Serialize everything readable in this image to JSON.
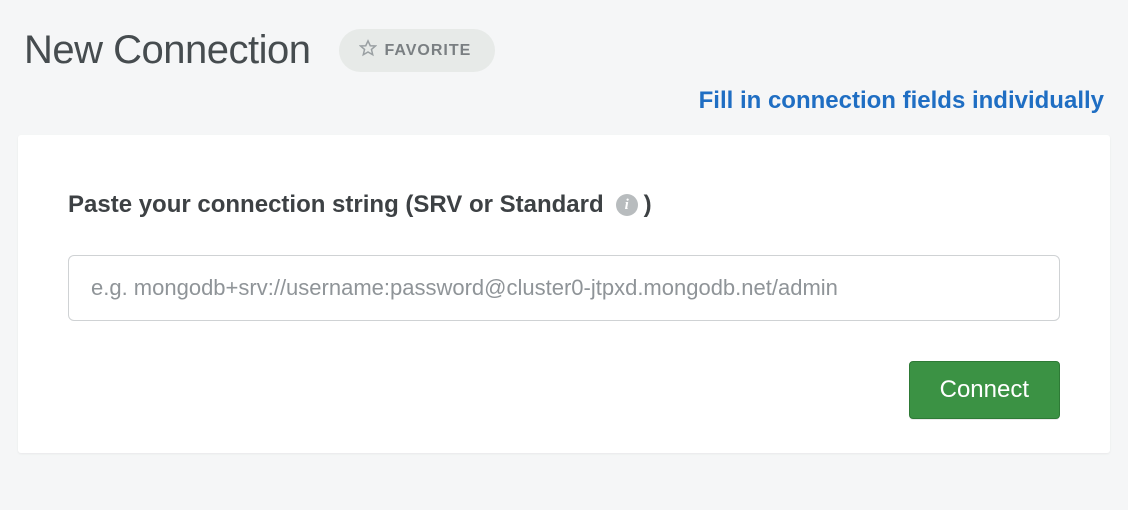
{
  "header": {
    "title": "New Connection",
    "favorite_label": "FAVORITE"
  },
  "links": {
    "fill_individually": "Fill in connection fields individually"
  },
  "form": {
    "label_prefix": "Paste your connection string (SRV or Standard",
    "label_suffix": ")",
    "input_value": "",
    "input_placeholder": "e.g. mongodb+srv://username:password@cluster0-jtpxd.mongodb.net/admin",
    "connect_label": "Connect"
  },
  "icons": {
    "star": "star-icon",
    "info": "info-icon"
  },
  "colors": {
    "accent_green": "#3b9244",
    "link_blue": "#1f6ec3",
    "page_bg": "#f5f6f7"
  }
}
